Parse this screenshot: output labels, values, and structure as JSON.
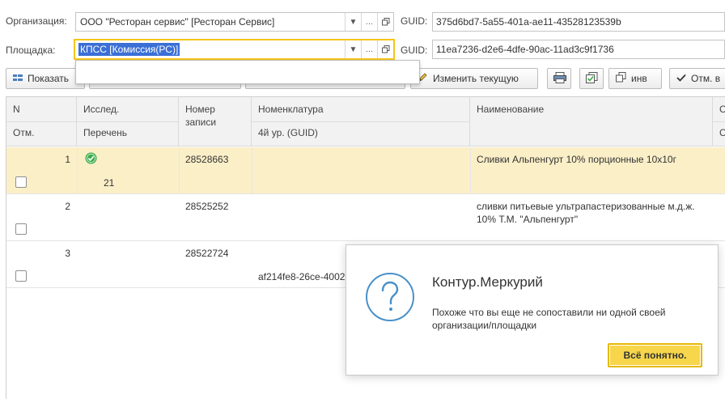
{
  "org": {
    "label": "Организация:",
    "value": "ООО \"Ресторан сервис\" [Ресторан Сервис]",
    "guid_label": "GUID:",
    "guid_value": "375d6bd7-5a55-401a-ae11-43528123539b"
  },
  "site": {
    "label": "Площадка:",
    "value": "КПСС [Комиссия(РС)]",
    "guid_label": "GUID:",
    "guid_value": "11ea7236-d2e6-4dfe-90ac-11ad3c9f1736"
  },
  "toolbar": {
    "show_label": "Показать",
    "edit_current_label": "Изменить текущую",
    "inv_label": "инв",
    "mark_label": "Отм. в"
  },
  "table": {
    "headers": {
      "n": "N",
      "mark": "Отм.",
      "research": "Исслед.",
      "list": "Перечень",
      "record_no": "Номер записи",
      "nomenclature": "Номенклатура",
      "level4": "4й ур. (GUID)",
      "name": "Наименование",
      "extra_top": "С",
      "extra_bottom": "С"
    },
    "rows": [
      {
        "n": "1",
        "list": "21",
        "record": "28528663",
        "guid": "",
        "name": "Сливки Альпенгурт 10% порционные 10х10г",
        "verified": true,
        "checked": false
      },
      {
        "n": "2",
        "list": "",
        "record": "28525252",
        "guid": "",
        "name": "сливки питьевые ультрапастеризованные м.д.ж. 10% Т.М. \"Альпенгурт\"",
        "verified": false,
        "checked": false
      },
      {
        "n": "3",
        "list": "",
        "record": "28522724",
        "guid": "af214fe8-26ce-4002",
        "name": "",
        "verified": false,
        "checked": false
      }
    ]
  },
  "popup": {
    "title": "Контур.Меркурий",
    "message": "Похоже что вы еще не сопоставили ни одной своей организации/площадки",
    "ok_label": "Всё понятно."
  },
  "colors": {
    "selected_row": "#fbefc8",
    "focus_border": "#f5c518",
    "ok_button": "#f7d64b",
    "icon_blue": "#4a90c8",
    "check_green": "#3cab4a"
  }
}
